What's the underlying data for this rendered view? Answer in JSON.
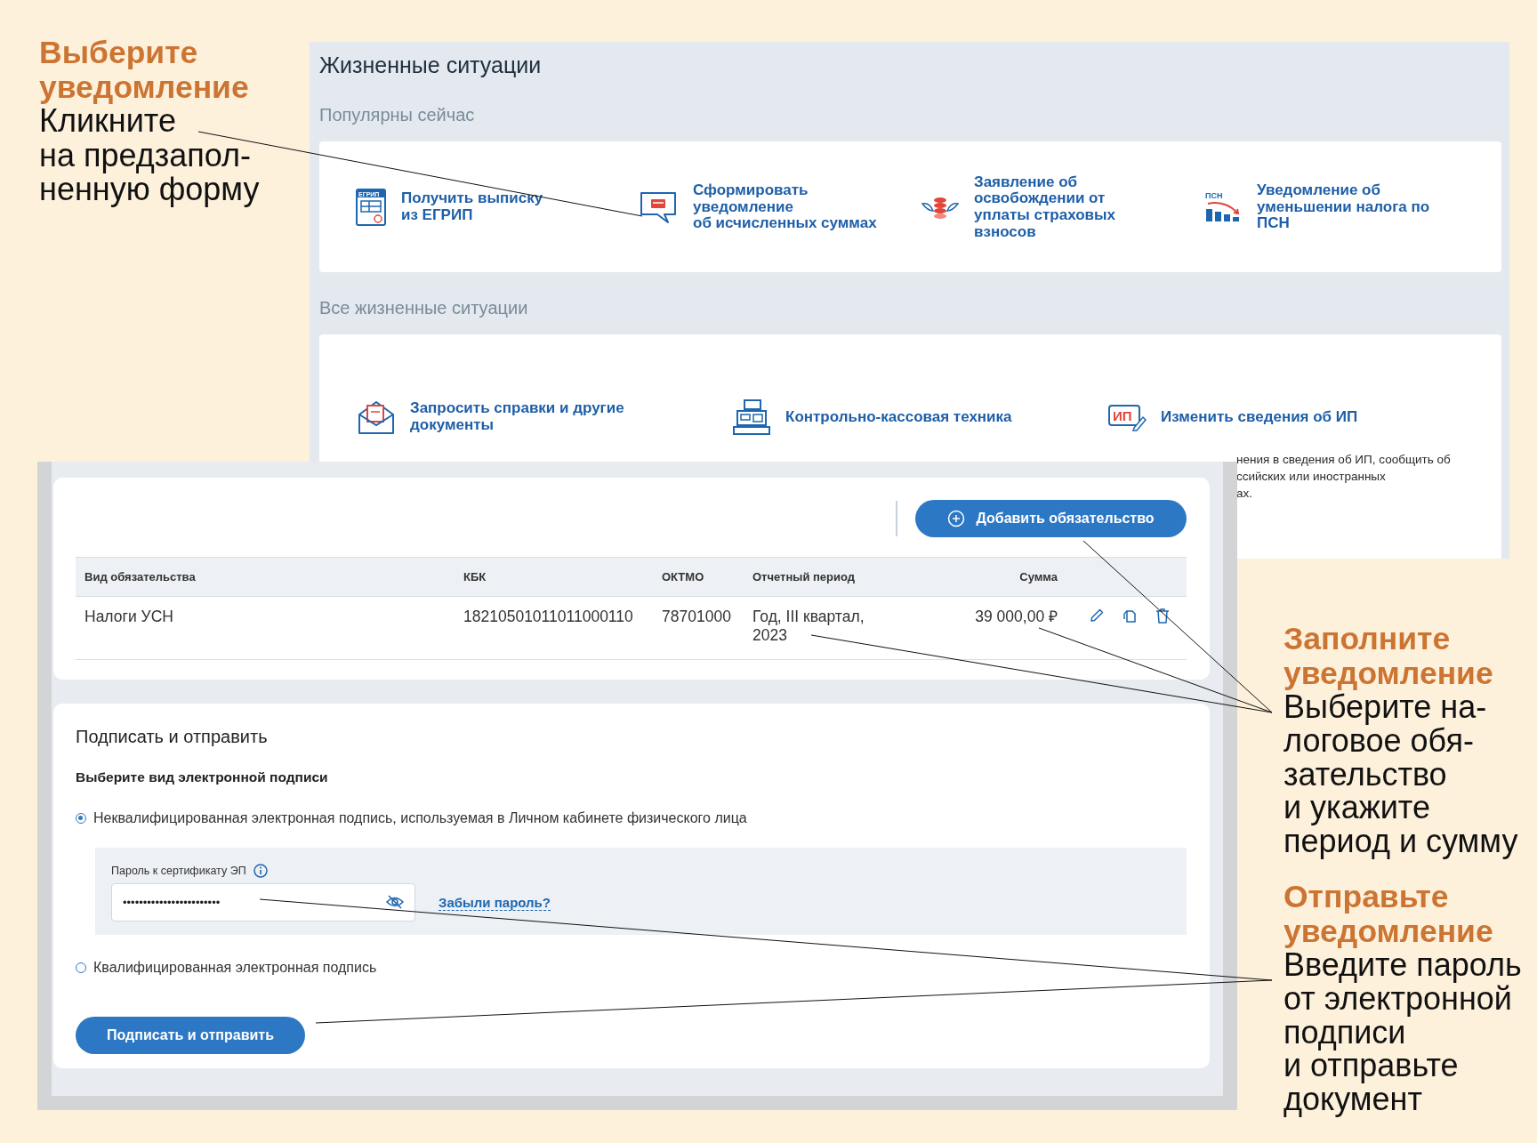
{
  "annotations": [
    {
      "title": "Выберите уведомление",
      "lines": [
        "Кликните",
        "на предзапол-",
        "ненную форму"
      ]
    },
    {
      "title": "Заполните уведомление",
      "lines": [
        "Выберите на-",
        "логовое обя-",
        "зательство",
        "и укажите",
        "период и сумму"
      ]
    },
    {
      "title": "Отправьте уведомление",
      "lines": [
        "Введите пароль",
        "от электронной",
        "подписи",
        "и отправьте",
        "документ"
      ]
    }
  ],
  "situations": {
    "title": "Жизненные ситуации",
    "popular": {
      "heading": "Популярны сейчас",
      "items": [
        {
          "label": "Получить выписку\nиз ЕГРИП",
          "icon_text": "ЕГРИП"
        },
        {
          "label": "Сформировать\nуведомление\nоб исчисленных суммах"
        },
        {
          "label": "Заявление об\nосвобождении от\nуплаты страховых\nвзносов"
        },
        {
          "label": "Уведомление об\nуменьшении налога по\nПСН",
          "icon_text": "ПСН"
        }
      ]
    },
    "all": {
      "heading": "Все жизненные ситуации",
      "items": [
        {
          "label": "Запросить справки и другие\nдокументы"
        },
        {
          "label": "Контрольно-кассовая техника"
        },
        {
          "label": "Изменить сведения об ИП",
          "icon_text": "ИП",
          "description_lines": [
            "нения в сведения об ИП, сообщить об",
            "ссийских или иностранных",
            "ах."
          ]
        }
      ]
    }
  },
  "obligations": {
    "add_button": "Добавить обязательство",
    "table": {
      "columns": [
        "Вид обязательства",
        "КБК",
        "ОКТМО",
        "Отчетный период",
        "Сумма"
      ],
      "rows": [
        {
          "cells": [
            "Налоги УСН",
            "18210501011011000110",
            "78701000",
            "Год, III квартал, 2023",
            "39 000,00 ₽"
          ]
        }
      ]
    }
  },
  "sign": {
    "title": "Подписать и отправить",
    "subtitle": "Выберите вид электронной подписи",
    "options": [
      {
        "label": "Неквалифицированная электронная подпись, используемая в Личном кабинете физического лица",
        "selected": true
      },
      {
        "label": "Квалифицированная электронная подпись",
        "selected": false
      }
    ],
    "password": {
      "label": "Пароль к сертификату ЭП",
      "value": "••••••••••••••••••••••••"
    },
    "forgot_link": "Забыли пароль?",
    "submit": "Подписать и отправить"
  }
}
